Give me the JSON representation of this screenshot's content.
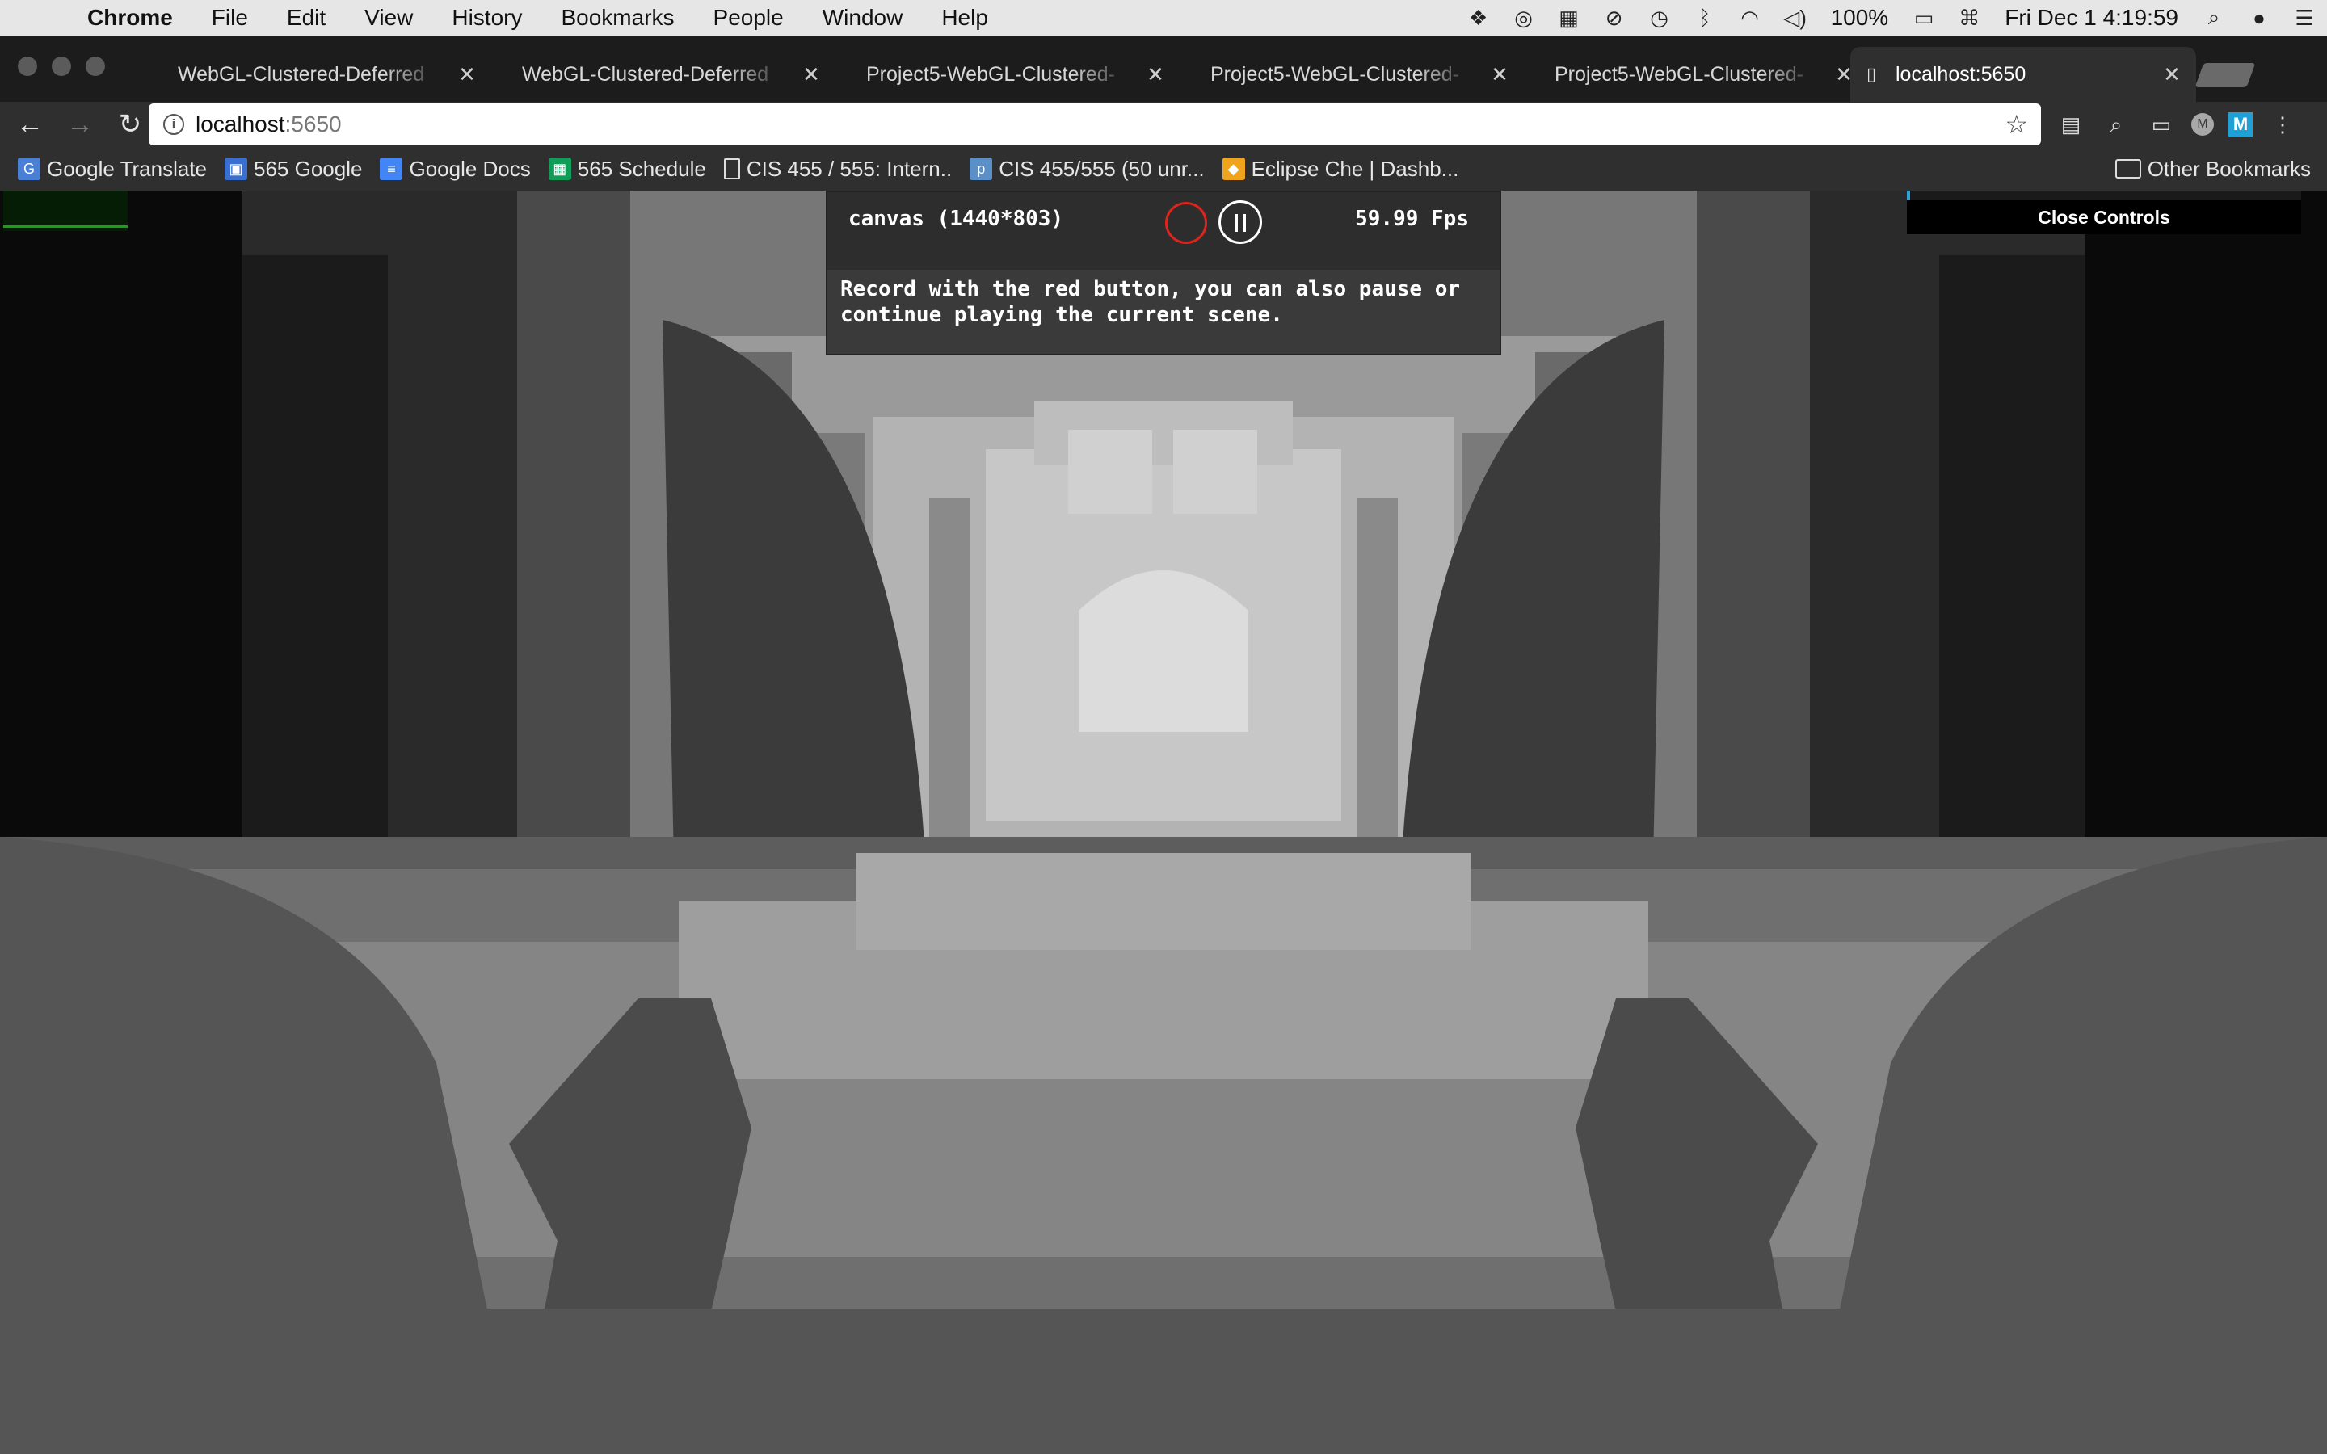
{
  "menubar": {
    "app_name": "Chrome",
    "menus": [
      "File",
      "Edit",
      "View",
      "History",
      "Bookmarks",
      "People",
      "Window",
      "Help"
    ],
    "battery": "100%",
    "datetime": "Fri Dec 1  4:19:59"
  },
  "tabs": [
    {
      "title": "WebGL-Clustered-Deferred",
      "active": false
    },
    {
      "title": "WebGL-Clustered-Deferred",
      "active": false
    },
    {
      "title": "Project5-WebGL-Clustered-",
      "active": false
    },
    {
      "title": "Project5-WebGL-Clustered-",
      "active": false
    },
    {
      "title": "Project5-WebGL-Clustered-",
      "active": false
    },
    {
      "title": "localhost:5650",
      "active": true
    }
  ],
  "toolbar": {
    "url_host": "localhost",
    "url_port": ":5650"
  },
  "bookmarks": [
    {
      "label": "Google Translate",
      "icon": "google-translate-icon",
      "color": "#4a7fd6"
    },
    {
      "label": "565 Google",
      "icon": "google-sites-icon",
      "color": "#3b6fcf"
    },
    {
      "label": "Google Docs",
      "icon": "google-docs-icon",
      "color": "#4285f4"
    },
    {
      "label": "565 Schedule",
      "icon": "google-sheets-icon",
      "color": "#0f9d58"
    },
    {
      "label": "CIS 455 / 555: Intern..",
      "icon": "page-icon",
      "color": ""
    },
    {
      "label": "CIS 455/555 (50 unr...",
      "icon": "piazza-icon",
      "color": "#5b8fc7"
    },
    {
      "label": "Eclipse Che | Dashb...",
      "icon": "eclipse-che-icon",
      "color": "#f0a31c"
    }
  ],
  "other_bookmarks": "Other Bookmarks",
  "recorder": {
    "canvas_label": "canvas (1440*803)",
    "fps": "59.99 Fps",
    "hint": "Record with the red button, you can also pause or continue playing the current scene.",
    "record_color": "#e0241d"
  },
  "gui": {
    "close_label": "Close Controls"
  }
}
